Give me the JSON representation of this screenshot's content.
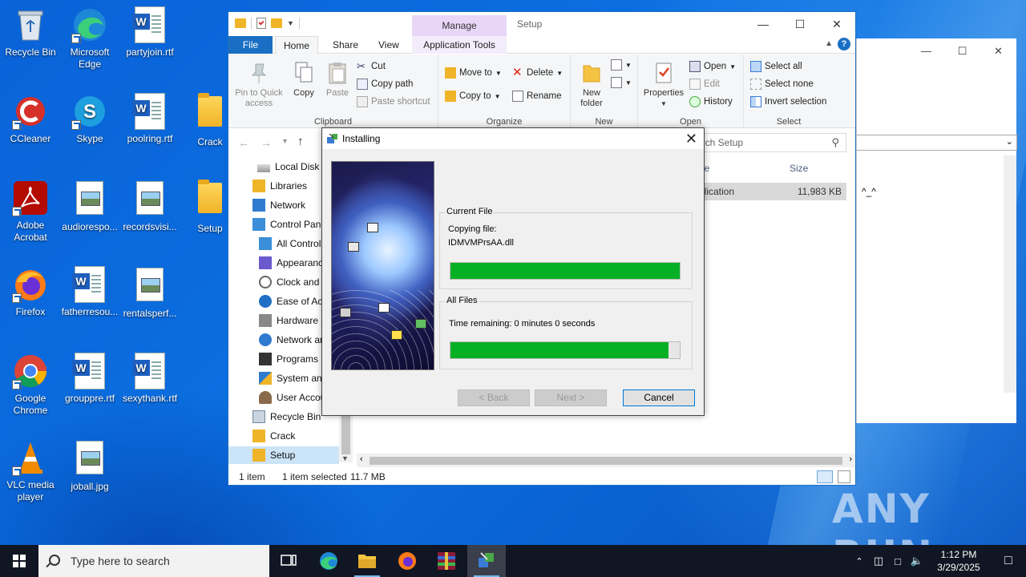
{
  "desktop": {
    "icons": [
      {
        "label": "Recycle Bin"
      },
      {
        "label": "Microsoft Edge"
      },
      {
        "label": "partyjoin.rtf"
      },
      {
        "label": "CCleaner"
      },
      {
        "label": "Skype"
      },
      {
        "label": "poolring.rtf"
      },
      {
        "label": "Crack"
      },
      {
        "label": "Adobe Acrobat"
      },
      {
        "label": "audiorespo..."
      },
      {
        "label": "recordsvisi..."
      },
      {
        "label": "Setup"
      },
      {
        "label": "Firefox"
      },
      {
        "label": "fatherresou..."
      },
      {
        "label": "rentalsperf..."
      },
      {
        "label": "Google Chrome"
      },
      {
        "label": "grouppre.rtf"
      },
      {
        "label": "sexythank.rtf"
      },
      {
        "label": "VLC media player"
      },
      {
        "label": "joball.jpg"
      }
    ],
    "watermark": "ANY RUN"
  },
  "explorer": {
    "title": "Setup",
    "context_tab": "Manage",
    "tabs": {
      "file": "File",
      "home": "Home",
      "share": "Share",
      "view": "View",
      "app_tools": "Application Tools"
    },
    "ribbon": {
      "clipboard": {
        "label": "Clipboard",
        "pin": "Pin to Quick access",
        "copy": "Copy",
        "paste": "Paste",
        "cut": "Cut",
        "copy_path": "Copy path",
        "paste_shortcut": "Paste shortcut"
      },
      "organize": {
        "label": "Organize",
        "move_to": "Move to",
        "copy_to": "Copy to",
        "delete": "Delete",
        "rename": "Rename"
      },
      "new": {
        "label": "New",
        "new_folder": "New folder"
      },
      "open": {
        "label": "Open",
        "properties": "Properties",
        "open": "Open",
        "edit": "Edit",
        "history": "History"
      },
      "select": {
        "label": "Select",
        "select_all": "Select all",
        "select_none": "Select none",
        "invert": "Invert selection"
      }
    },
    "search_placeholder": "Search Setup",
    "search_visible": "arch Setup",
    "nav": [
      {
        "label": "Local Disk (C:)",
        "shown": "Local Disk"
      },
      {
        "label": "Libraries",
        "shown": "Libraries"
      },
      {
        "label": "Network",
        "shown": "Network"
      },
      {
        "label": "Control Panel",
        "shown": "Control Pan"
      },
      {
        "label": "All Control Panel Items",
        "shown": "All Control"
      },
      {
        "label": "Appearance",
        "shown": "Appearanc"
      },
      {
        "label": "Clock and Region",
        "shown": "Clock and"
      },
      {
        "label": "Ease of Access",
        "shown": "Ease of Acc"
      },
      {
        "label": "Hardware and Sound",
        "shown": "Hardware a"
      },
      {
        "label": "Network and Internet",
        "shown": "Network ar"
      },
      {
        "label": "Programs",
        "shown": "Programs"
      },
      {
        "label": "System and Security",
        "shown": "System and"
      },
      {
        "label": "User Accounts",
        "shown": "User Accou"
      },
      {
        "label": "Recycle Bin",
        "shown": "Recycle Bin"
      },
      {
        "label": "Crack",
        "shown": "Crack"
      },
      {
        "label": "Setup",
        "shown": "Setup"
      }
    ],
    "columns": {
      "type": "pe",
      "size": "Size"
    },
    "row": {
      "type": "plication",
      "size": "11,983 KB"
    },
    "status": {
      "count": "1 item",
      "selected": "1 item selected",
      "size": "11.7 MB"
    }
  },
  "window2": {
    "text": "^_^"
  },
  "installer": {
    "title": "Installing",
    "current_file_label": "Current File",
    "copying_label": "Copying file:",
    "file_name": "IDMVMPrsAA.dll",
    "current_progress": 1.0,
    "all_files_label": "All Files",
    "time_remaining": "Time remaining: 0 minutes 0 seconds",
    "all_progress": 0.95,
    "back_label": "< Back",
    "next_label": "Next >",
    "cancel_label": "Cancel"
  },
  "taskbar": {
    "search_placeholder": "Type here to search",
    "time": "1:12 PM",
    "date": "3/29/2025"
  },
  "colors": {
    "accent": "#0078d7",
    "progress": "#06b025",
    "taskbar": "#101623",
    "file_tab": "#1a6fc4"
  }
}
